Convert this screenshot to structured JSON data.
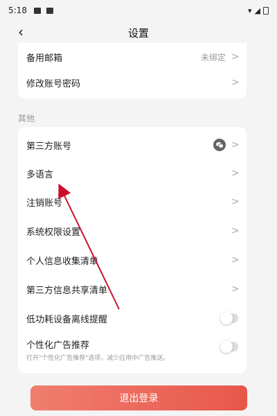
{
  "status_bar": {
    "time": "5:18"
  },
  "nav": {
    "back_icon": "‹",
    "title": "设置"
  },
  "account": {
    "rows": [
      {
        "label": "备用邮箱",
        "value": "未绑定"
      },
      {
        "label": "修改账号密码",
        "value": ""
      }
    ]
  },
  "section_other": {
    "title": "其他"
  },
  "other": {
    "rows": [
      {
        "label": "第三方账号"
      },
      {
        "label": "多语言"
      },
      {
        "label": "注销账号"
      },
      {
        "label": "系统权限设置"
      },
      {
        "label": "个人信息收集清单"
      },
      {
        "label": "第三方信息共享清单"
      },
      {
        "label": "低功耗设备离线提醒"
      },
      {
        "label": "个性化广告推荐",
        "subtext": "打开\"个性化广告推荐\"选项，减少应用中广告推送。"
      }
    ]
  },
  "logout": {
    "label": "退出登录"
  },
  "colors": {
    "accent": "#e8574a",
    "annotation_arrow": "#c8102e"
  },
  "icons": [
    "back-icon",
    "chevron-right-icon",
    "wechat-icon",
    "toggle-switch"
  ]
}
